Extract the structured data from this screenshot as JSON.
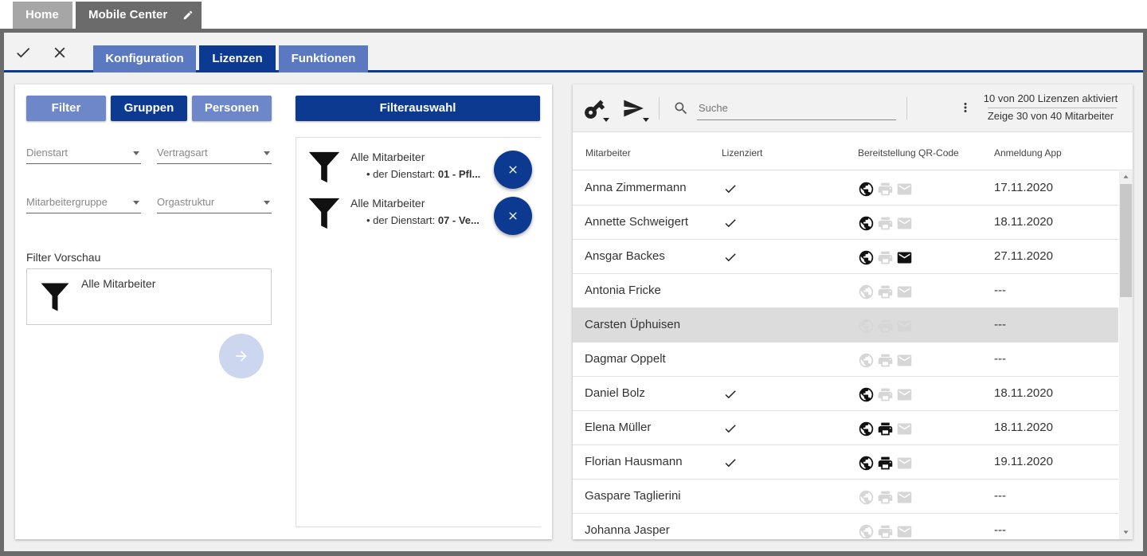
{
  "top_tabs": {
    "home": "Home",
    "mobile_center": "Mobile Center"
  },
  "main_tabs": [
    {
      "label": "Konfiguration"
    },
    {
      "label": "Lizenzen"
    },
    {
      "label": "Funktionen"
    }
  ],
  "left": {
    "buttons": {
      "filter": "Filter",
      "gruppen": "Gruppen",
      "personen": "Personen",
      "filterauswahl": "Filterauswahl"
    },
    "dropdowns": {
      "dienstart": "Dienstart",
      "vertragsart": "Vertragsart",
      "mitarbeitergruppe": "Mitarbeitergruppe",
      "orgastruktur": "Orgastruktur"
    },
    "filter_preview_label": "Filter Vorschau",
    "filter_preview_text": "Alle Mitarbeiter",
    "selected_filters": [
      {
        "title": "Alle Mitarbeiter",
        "sub_prefix": "der Dienstart: ",
        "sub_value": "01 - Pfl..."
      },
      {
        "title": "Alle Mitarbeiter",
        "sub_prefix": "der Dienstart: ",
        "sub_value": "07 - Ve..."
      }
    ]
  },
  "right": {
    "search_placeholder": "Suche",
    "stat_licenses": "10 von 200 Lizenzen aktiviert",
    "stat_employees": "Zeige 30 von 40 Mitarbeiter",
    "columns": [
      "Mitarbeiter",
      "Lizenziert",
      "Bereitstellung QR-Code",
      "Anmeldung App"
    ],
    "rows": [
      {
        "name": "Anna Zimmermann",
        "licensed": true,
        "web": true,
        "print": false,
        "mail": false,
        "date": "17.11.2020"
      },
      {
        "name": "Annette Schweigert",
        "licensed": true,
        "web": true,
        "print": false,
        "mail": false,
        "date": "18.11.2020"
      },
      {
        "name": "Ansgar Backes",
        "licensed": true,
        "web": true,
        "print": false,
        "mail": true,
        "date": "27.11.2020"
      },
      {
        "name": "Antonia Fricke",
        "licensed": false,
        "web": false,
        "print": false,
        "mail": false,
        "date": "---"
      },
      {
        "name": "Carsten Üphuisen",
        "licensed": false,
        "web": false,
        "print": false,
        "mail": false,
        "date": "---",
        "selected": true
      },
      {
        "name": "Dagmar Oppelt",
        "licensed": false,
        "web": false,
        "print": false,
        "mail": false,
        "date": "---"
      },
      {
        "name": "Daniel Bolz",
        "licensed": true,
        "web": true,
        "print": false,
        "mail": false,
        "date": "18.11.2020"
      },
      {
        "name": "Elena Müller",
        "licensed": true,
        "web": true,
        "print": true,
        "mail": false,
        "date": "18.11.2020"
      },
      {
        "name": "Florian Hausmann",
        "licensed": true,
        "web": true,
        "print": true,
        "mail": false,
        "date": "19.11.2020"
      },
      {
        "name": "Gaspare Taglierini",
        "licensed": false,
        "web": false,
        "print": false,
        "mail": false,
        "date": "---"
      },
      {
        "name": "Johanna Jasper",
        "licensed": false,
        "web": false,
        "print": false,
        "mail": false,
        "date": "---"
      }
    ]
  },
  "colors": {
    "primary": "#0d3a91",
    "secondary": "#5a79c1",
    "frame": "#6b6b6b"
  }
}
